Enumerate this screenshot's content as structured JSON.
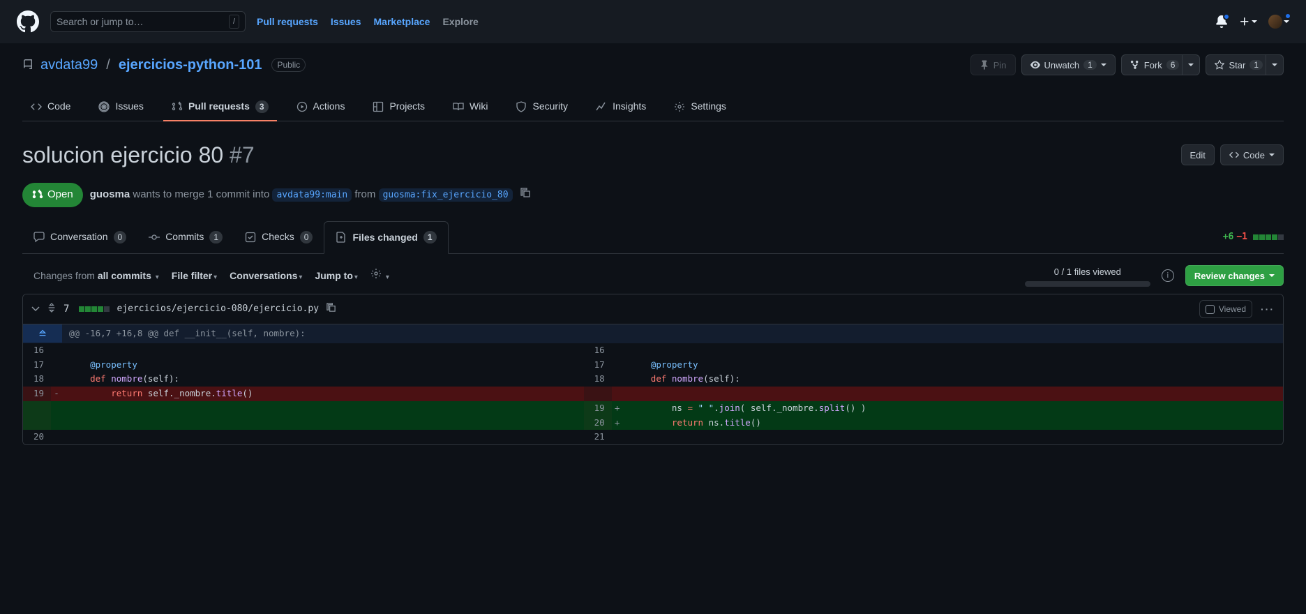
{
  "header": {
    "search_placeholder": "Search or jump to…",
    "slash": "/",
    "nav": {
      "pulls": "Pull requests",
      "issues": "Issues",
      "marketplace": "Marketplace",
      "explore": "Explore"
    }
  },
  "repo": {
    "owner": "avdata99",
    "name": "ejercicios-python-101",
    "visibility": "Public",
    "actions": {
      "pin": "Pin",
      "unwatch": "Unwatch",
      "watch_count": "1",
      "fork": "Fork",
      "fork_count": "6",
      "star": "Star",
      "star_count": "1"
    }
  },
  "repo_tabs": {
    "code": "Code",
    "issues": "Issues",
    "pulls": "Pull requests",
    "pulls_count": "3",
    "actions": "Actions",
    "projects": "Projects",
    "wiki": "Wiki",
    "security": "Security",
    "insights": "Insights",
    "settings": "Settings"
  },
  "pr": {
    "title": "solucion ejercicio 80",
    "number": "#7",
    "state": "Open",
    "author": "guosma",
    "meta_a": " wants to merge 1 commit into ",
    "base": "avdata99:main",
    "meta_b": " from ",
    "head": "guosma:fix_ejercicio_80",
    "edit": "Edit",
    "code_btn": "Code"
  },
  "pr_tabs": {
    "conversation": "Conversation",
    "conversation_c": "0",
    "commits": "Commits",
    "commits_c": "1",
    "checks": "Checks",
    "checks_c": "0",
    "files": "Files changed",
    "files_c": "1",
    "add": "+6",
    "del": "−1"
  },
  "toolbar": {
    "changes_from_a": "Changes from",
    "changes_from_b": "all commits",
    "file_filter": "File filter",
    "conversations": "Conversations",
    "jump_to": "Jump to",
    "viewed_progress": "0 / 1 files viewed",
    "review": "Review changes"
  },
  "file": {
    "count": "7",
    "path": "ejercicios/ejercicio-080/ejercicio.py",
    "viewed": "Viewed"
  },
  "diff": {
    "hunk": "@@ -16,7 +16,8 @@ def __init__(self, nombre):",
    "rows": [
      {
        "l": "16",
        "r": "16",
        "t": "ctx",
        "text": ""
      },
      {
        "l": "17",
        "r": "17",
        "t": "ctx",
        "html": "    <span class='tok-d'>@property</span>"
      },
      {
        "l": "18",
        "r": "18",
        "t": "ctx",
        "html": "    <span class='tok-k'>def</span> <span class='tok-f'>nombre</span>(<span class='tok-v'>self</span>):"
      },
      {
        "l": "19",
        "r": "",
        "t": "del",
        "html": "        <span class='tok-k'>return</span> <span class='tok-v'>self</span>.<span class='tok-v'>_nombre</span>.<span class='tok-f'>title</span>()"
      },
      {
        "l": "",
        "r": "19",
        "t": "add",
        "hl": true,
        "html": "        <span class='tok-v'>ns</span> <span class='tok-k'>=</span> <span class='tok-s'>\" \"</span>.<span class='tok-f'>join</span>( <span class='tok-v'>self</span>.<span class='tok-v'>_nombre</span>.<span class='tok-f'>split</span>() )"
      },
      {
        "l": "",
        "r": "20",
        "t": "add",
        "hl": true,
        "html": "        <span class='tok-k'>return</span> <span class='tok-v'>ns</span>.<span class='tok-f'>title</span>()"
      },
      {
        "l": "20",
        "r": "21",
        "t": "ctx",
        "text": ""
      }
    ]
  }
}
